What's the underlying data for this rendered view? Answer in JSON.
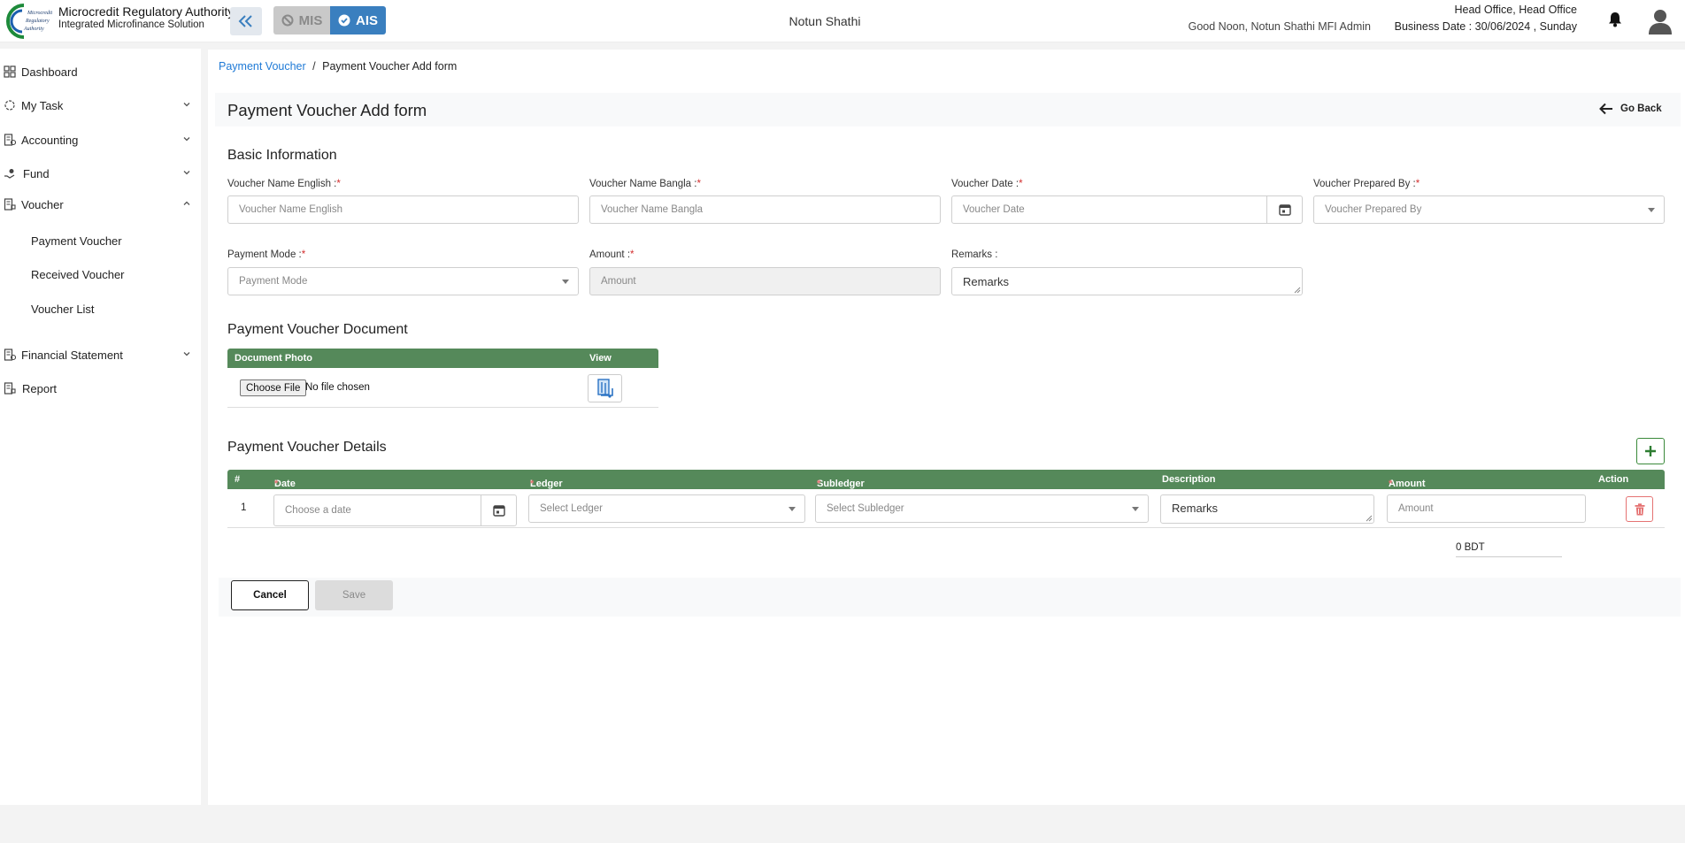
{
  "header": {
    "brand_title": "Microcredit Regulatory Authority",
    "brand_subtitle": "Integrated Microfinance Solution",
    "mis_label": "MIS",
    "ais_label": "AIS",
    "org_name": "Notun Shathi",
    "greeting": "Good Noon, Notun Shathi MFI Admin",
    "office": "Head Office, Head Office",
    "business_date": "Business Date : 30/06/2024 , Sunday"
  },
  "sidebar": {
    "items": [
      {
        "label": "Dashboard",
        "icon": "grid-icon"
      },
      {
        "label": "My Task",
        "icon": "task-icon"
      },
      {
        "label": "Accounting",
        "icon": "accounting-icon"
      },
      {
        "label": "Fund",
        "icon": "fund-icon"
      },
      {
        "label": "Voucher",
        "icon": "voucher-icon"
      },
      {
        "label": "Financial Statement",
        "icon": "statement-icon"
      },
      {
        "label": "Report",
        "icon": "report-icon"
      }
    ],
    "voucher_sub": [
      "Payment Voucher",
      "Received Voucher",
      "Voucher List"
    ]
  },
  "breadcrumb": {
    "link": "Payment Voucher",
    "separator": "/",
    "current": "Payment Voucher Add form"
  },
  "page": {
    "title": "Payment Voucher Add form",
    "go_back": "Go Back"
  },
  "basic_info": {
    "title": "Basic Information",
    "fields": {
      "name_en": {
        "label": "Voucher Name English :",
        "placeholder": "Voucher Name English"
      },
      "name_bn": {
        "label": "Voucher Name Bangla :",
        "placeholder": "Voucher Name Bangla"
      },
      "date": {
        "label": "Voucher Date :",
        "placeholder": "Voucher Date"
      },
      "prepared_by": {
        "label": "Voucher Prepared By :",
        "placeholder": "Voucher Prepared By"
      },
      "payment_mode": {
        "label": "Payment Mode :",
        "placeholder": "Payment Mode"
      },
      "amount": {
        "label": "Amount :",
        "placeholder": "Amount"
      },
      "remarks": {
        "label": "Remarks :",
        "placeholder": "Remarks"
      }
    },
    "required_mark": "*"
  },
  "document": {
    "title": "Payment Voucher Document",
    "col_photo": "Document Photo",
    "col_view": "View",
    "choose_file": "Choose File",
    "no_file": "No file chosen"
  },
  "details": {
    "title": "Payment Voucher Details",
    "columns": {
      "num": "#",
      "date": "Date",
      "ledger": "Ledger",
      "subledger": "Subledger",
      "description": "Description",
      "amount": "Amount",
      "action": "Action"
    },
    "required_mark": "*",
    "row": {
      "num": "1",
      "date_placeholder": "Choose a date",
      "ledger_placeholder": "Select Ledger",
      "subledger_placeholder": "Select Subledger",
      "description_placeholder": "Remarks",
      "amount_placeholder": "Amount"
    },
    "total": "0 BDT"
  },
  "actions": {
    "cancel": "Cancel",
    "save": "Save"
  }
}
